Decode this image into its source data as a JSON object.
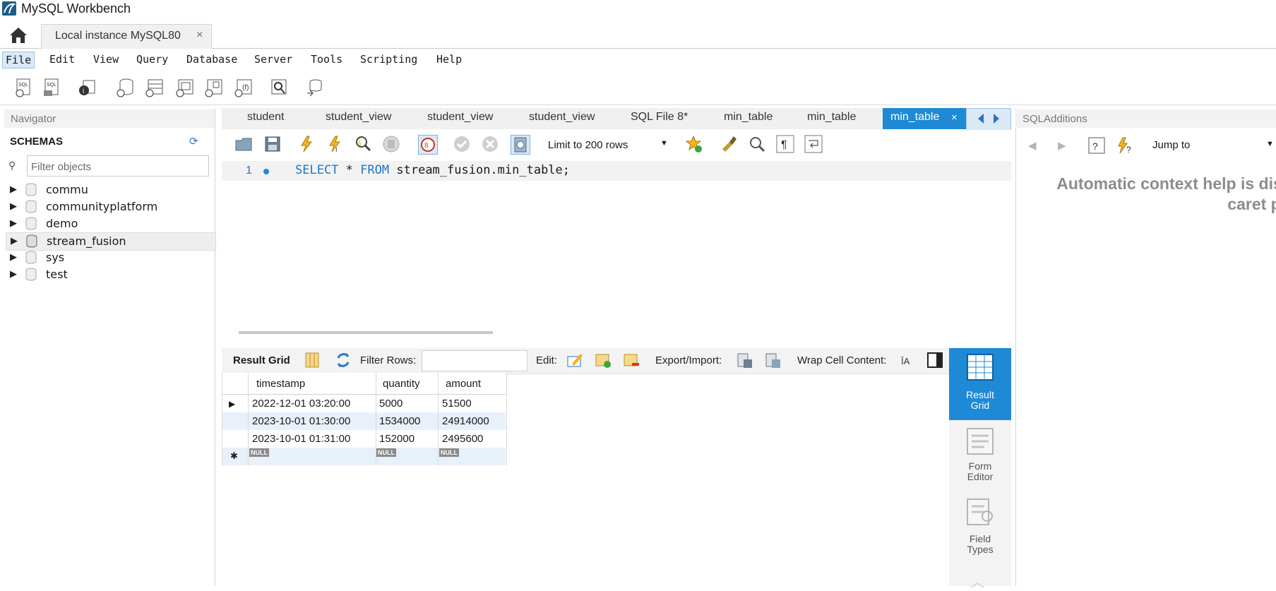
{
  "window": {
    "title": "MySQL Workbench"
  },
  "connection_tab": {
    "label": "Local instance MySQL80",
    "close": "×"
  },
  "menu": [
    "File",
    "Edit",
    "View",
    "Query",
    "Database",
    "Server",
    "Tools",
    "Scripting",
    "Help"
  ],
  "navigator": {
    "title": "Navigator",
    "schemas_label": "SCHEMAS",
    "filter_placeholder": "Filter objects",
    "schemas": [
      "commu",
      "communityplatform",
      "demo",
      "stream_fusion",
      "sys",
      "test"
    ],
    "selected_schema": "stream_fusion"
  },
  "editor_tabs": [
    "student",
    "student_view",
    "student_view",
    "student_view",
    "SQL File 8*",
    "min_table",
    "min_table",
    "min_table"
  ],
  "active_tab": {
    "label": "min_table",
    "close": "×"
  },
  "sql_toolbar": {
    "limit_label": "Limit to 200 rows"
  },
  "editor": {
    "line_number": "1",
    "sql_keyword1": "SELECT",
    "sql_star": "*",
    "sql_keyword2": "FROM",
    "sql_rest": "stream_fusion.min_table;"
  },
  "result_toolbar": {
    "result_grid": "Result Grid",
    "filter_rows": "Filter Rows:",
    "edit": "Edit:",
    "export_import": "Export/Import:",
    "wrap_cell": "Wrap Cell Content:"
  },
  "result_grid": {
    "columns": [
      "timestamp",
      "quantity",
      "amount"
    ],
    "rows": [
      [
        "2022-12-01 03:20:00",
        "5000",
        "51500"
      ],
      [
        "2023-10-01 01:30:00",
        "1534000",
        "24914000"
      ],
      [
        "2023-10-01 01:31:00",
        "152000",
        "2495600"
      ]
    ],
    "null_label": "NULL"
  },
  "side_switcher": {
    "result_grid_l1": "Result",
    "result_grid_l2": "Grid",
    "form_editor_l1": "Form",
    "form_editor_l2": "Editor",
    "field_types_l1": "Field",
    "field_types_l2": "Types"
  },
  "sql_additions": {
    "title": "SQLAdditions",
    "jump_to": "Jump to",
    "help_line1": "Automatic context help is dis",
    "help_line2": "caret p"
  },
  "colors": {
    "accent": "#1e8ad6",
    "keyword": "#1e77c6"
  }
}
